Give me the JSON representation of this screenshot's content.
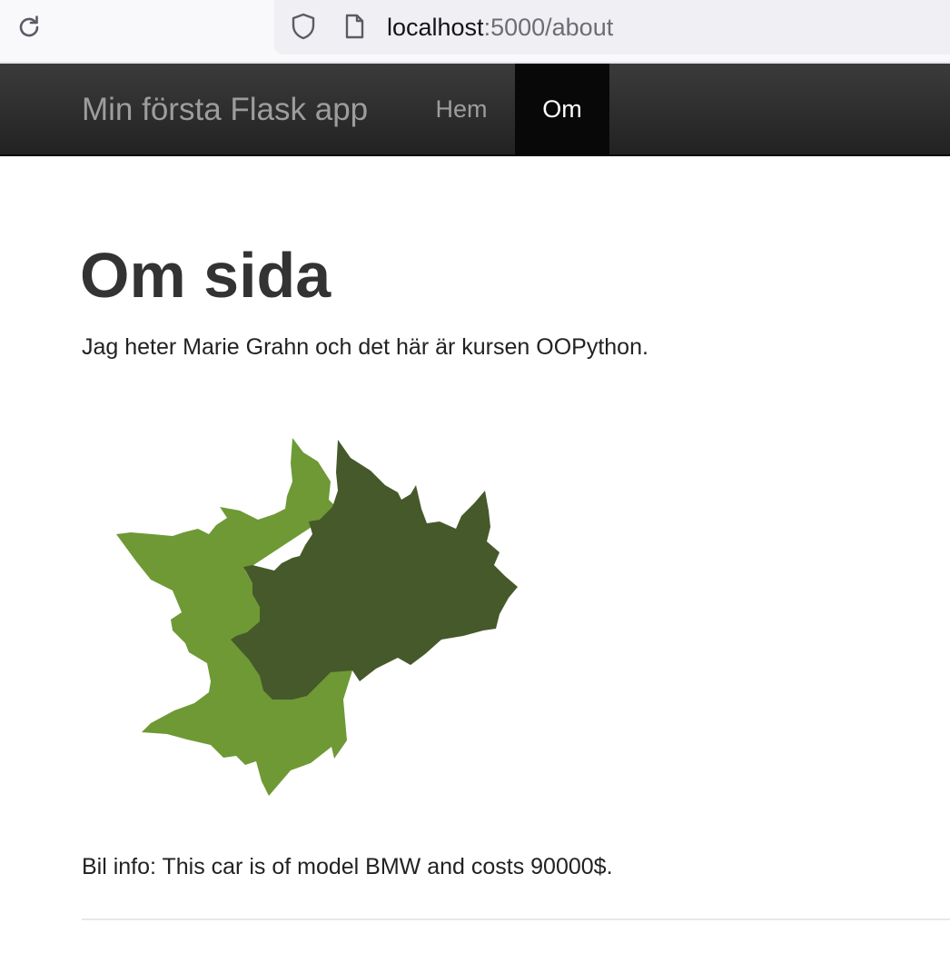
{
  "browser": {
    "url_host": "localhost",
    "url_path": ":5000/about",
    "icons": [
      "reload-icon",
      "shield-icon",
      "page-icon"
    ]
  },
  "navbar": {
    "brand": "Min första Flask app",
    "items": [
      {
        "label": "Hem",
        "active": false
      },
      {
        "label": "Om",
        "active": true
      }
    ]
  },
  "main": {
    "title": "Om sida",
    "intro": "Jag heter Marie Grahn och det här är kursen OOPython.",
    "car_info": "Bil info: This car is of model BMW and costs 90000$."
  },
  "colors": {
    "navbar_bg": "#222222",
    "active_nav_bg": "#080808",
    "leaf_light": "#6e9935",
    "leaf_dark": "#46592a"
  }
}
